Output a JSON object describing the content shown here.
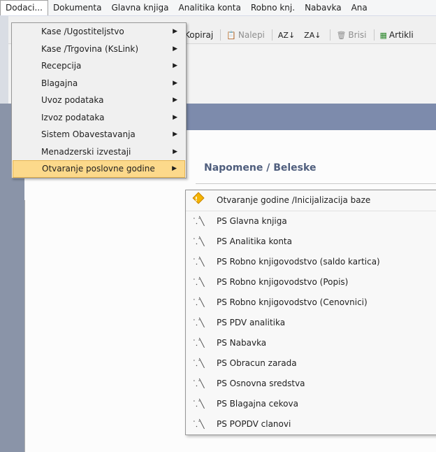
{
  "menubar": {
    "items": [
      {
        "label": "Dodaci...",
        "active": true
      },
      {
        "label": "Dokumenta"
      },
      {
        "label": "Glavna knjiga"
      },
      {
        "label": "Analitika konta"
      },
      {
        "label": "Robno knj."
      },
      {
        "label": "Nabavka"
      },
      {
        "label": "Ana"
      }
    ]
  },
  "toolbar": {
    "copy": "Kopiraj",
    "paste": "Nalepi",
    "sort_asc_icon": "AZ↓",
    "sort_desc_icon": "ZA↓",
    "delete": "Brisi",
    "articles": "Artikli"
  },
  "panel": {
    "notes_title": "Napomene / Beleske"
  },
  "menu": {
    "items": [
      {
        "label": "Kase /Ugostiteljstvo"
      },
      {
        "label": "Kase /Trgovina (KsLink)"
      },
      {
        "label": "Recepcija"
      },
      {
        "label": "Blagajna"
      },
      {
        "label": "Uvoz podataka"
      },
      {
        "label": "Izvoz podataka"
      },
      {
        "label": "Sistem Obavestavanja"
      },
      {
        "label": "Menadzerski izvestaji"
      },
      {
        "label": "Otvaranje poslovne godine",
        "highlighted": true
      }
    ],
    "arrow": "▶"
  },
  "submenu": {
    "items": [
      {
        "label": "Otvaranje godine /Inicijalizacija baze",
        "icon": "warning-diamond-icon"
      },
      {
        "label": "PS Glavna knjiga",
        "icon": "ps-tool-icon"
      },
      {
        "label": "PS Analitika konta",
        "icon": "ps-tool-icon"
      },
      {
        "label": "PS Robno knjigovodstvo (saldo kartica)",
        "icon": "ps-tool-icon"
      },
      {
        "label": "PS Robno knjigovodstvo (Popis)",
        "icon": "ps-tool-icon"
      },
      {
        "label": "PS Robno knjigovodstvo (Cenovnici)",
        "icon": "ps-tool-icon"
      },
      {
        "label": "PS PDV analitika",
        "icon": "ps-tool-icon"
      },
      {
        "label": "PS Nabavka",
        "icon": "ps-tool-icon"
      },
      {
        "label": "PS Obracun zarada",
        "icon": "ps-tool-icon"
      },
      {
        "label": "PS Osnovna sredstva",
        "icon": "ps-tool-icon"
      },
      {
        "label": "PS Blagajna cekova",
        "icon": "ps-tool-icon"
      },
      {
        "label": "PS POPDV clanovi",
        "icon": "ps-tool-icon"
      }
    ],
    "ps_glyph": "⸪╲"
  },
  "colors": {
    "highlight": "#fcd98b",
    "bluebar": "#7d8bac",
    "notes_title": "#4f5e7d"
  }
}
